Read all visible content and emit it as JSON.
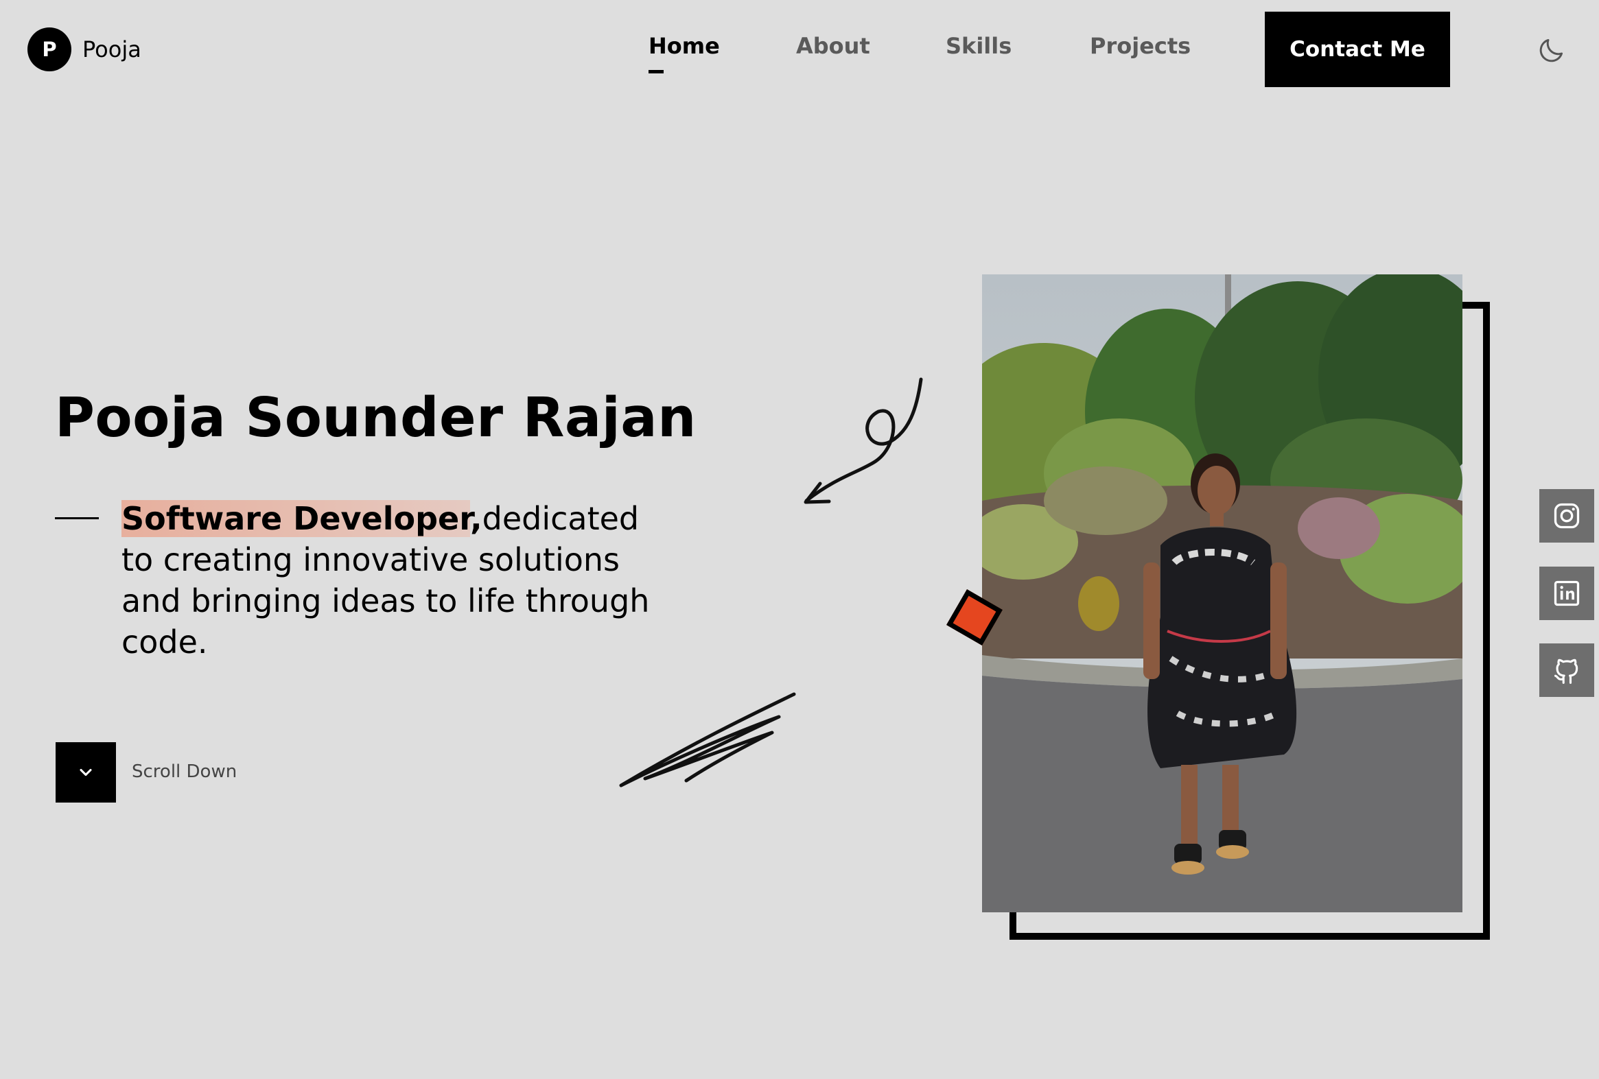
{
  "header": {
    "logo_letter": "P",
    "logo_name": "Pooja",
    "nav": [
      {
        "label": "Home",
        "active": true
      },
      {
        "label": "About",
        "active": false
      },
      {
        "label": "Skills",
        "active": false
      },
      {
        "label": "Projects",
        "active": false
      }
    ],
    "contact_label": "Contact Me",
    "theme_icon": "moon-icon"
  },
  "hero": {
    "name": "Pooja Sounder Rajan",
    "role": "Software Developer",
    "role_suffix": ",",
    "description": "dedicated to creating innovative solutions and bringing ideas to life through code.",
    "scroll_label": "Scroll Down",
    "accent_color": "#e5461f"
  },
  "social": [
    {
      "icon": "instagram-icon"
    },
    {
      "icon": "linkedin-icon"
    },
    {
      "icon": "github-icon"
    }
  ]
}
